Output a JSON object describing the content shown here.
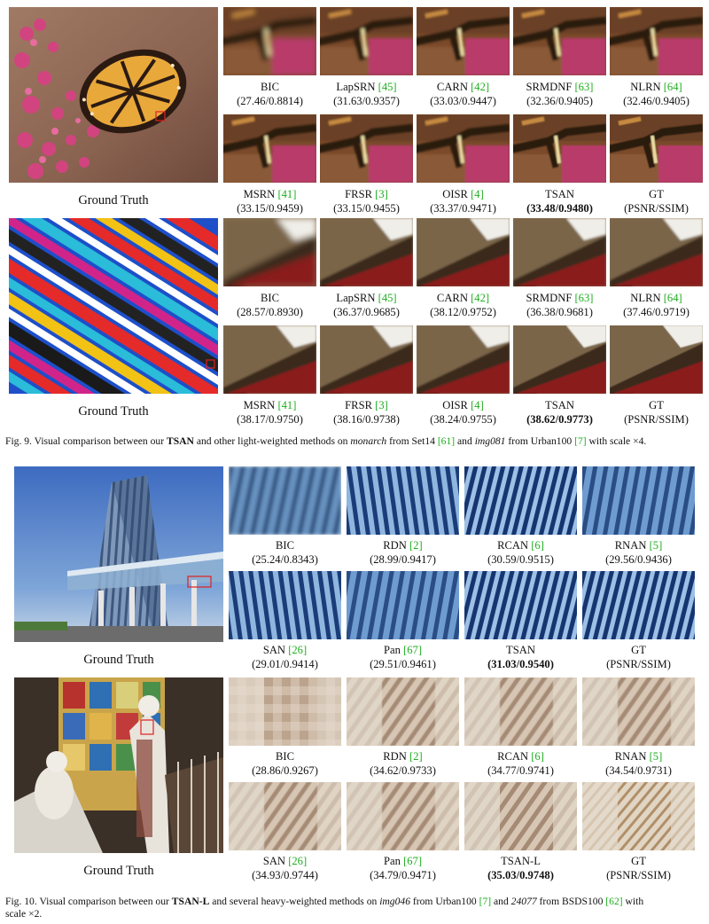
{
  "fig9": {
    "rows": [
      {
        "ground_truth_label": "Ground Truth",
        "crops": [
          {
            "method": "BIC",
            "ref": "",
            "score": "(27.46/0.8814)",
            "bold": false
          },
          {
            "method": "LapSRN",
            "ref": "[45]",
            "score": "(31.63/0.9357)",
            "bold": false
          },
          {
            "method": "CARN",
            "ref": "[42]",
            "score": "(33.03/0.9447)",
            "bold": false
          },
          {
            "method": "SRMDNF",
            "ref": "[63]",
            "score": "(32.36/0.9405)",
            "bold": false
          },
          {
            "method": "NLRN",
            "ref": "[64]",
            "score": "(32.46/0.9405)",
            "bold": false
          },
          {
            "method": "MSRN",
            "ref": "[41]",
            "score": "(33.15/0.9459)",
            "bold": false
          },
          {
            "method": "FRSR",
            "ref": "[3]",
            "score": "(33.15/0.9455)",
            "bold": false
          },
          {
            "method": "OISR",
            "ref": "[4]",
            "score": "(33.37/0.9471)",
            "bold": false
          },
          {
            "method": "TSAN",
            "ref": "",
            "score": "(33.48/0.9480)",
            "bold": true
          },
          {
            "method": "GT",
            "ref": "",
            "score": "(PSNR/SSIM)",
            "bold": false
          }
        ]
      },
      {
        "ground_truth_label": "Ground Truth",
        "crops": [
          {
            "method": "BIC",
            "ref": "",
            "score": "(28.57/0.8930)",
            "bold": false
          },
          {
            "method": "LapSRN",
            "ref": "[45]",
            "score": "(36.37/0.9685)",
            "bold": false
          },
          {
            "method": "CARN",
            "ref": "[42]",
            "score": "(38.12/0.9752)",
            "bold": false
          },
          {
            "method": "SRMDNF",
            "ref": "[63]",
            "score": "(36.38/0.9681)",
            "bold": false
          },
          {
            "method": "NLRN",
            "ref": "[64]",
            "score": "(37.46/0.9719)",
            "bold": false
          },
          {
            "method": "MSRN",
            "ref": "[41]",
            "score": "(38.17/0.9750)",
            "bold": false
          },
          {
            "method": "FRSR",
            "ref": "[3]",
            "score": "(38.16/0.9738)",
            "bold": false
          },
          {
            "method": "OISR",
            "ref": "[4]",
            "score": "(38.24/0.9755)",
            "bold": false
          },
          {
            "method": "TSAN",
            "ref": "",
            "score": "(38.62/0.9773)",
            "bold": true
          },
          {
            "method": "GT",
            "ref": "",
            "score": "(PSNR/SSIM)",
            "bold": false
          }
        ]
      }
    ],
    "caption": {
      "prefix": "Fig. 9.  Visual comparison between our ",
      "model": "TSAN",
      "mid1": " and other light-weighted methods on ",
      "img1": "monarch",
      "mid2": " from Set14 ",
      "ref1": "[61]",
      "mid3": " and ",
      "img2": "img081",
      "mid4": " from Urban100 ",
      "ref2": "[7]",
      "suffix": " with scale ×4."
    }
  },
  "fig10": {
    "rows": [
      {
        "ground_truth_label": "Ground Truth",
        "crops": [
          {
            "method": "BIC",
            "ref": "",
            "score": "(25.24/0.8343)",
            "bold": false
          },
          {
            "method": "RDN",
            "ref": "[2]",
            "score": "(28.99/0.9417)",
            "bold": false
          },
          {
            "method": "RCAN",
            "ref": "[6]",
            "score": "(30.59/0.9515)",
            "bold": false
          },
          {
            "method": "RNAN",
            "ref": "[5]",
            "score": "(29.56/0.9436)",
            "bold": false
          },
          {
            "method": "SAN",
            "ref": "[26]",
            "score": "(29.01/0.9414)",
            "bold": false
          },
          {
            "method": "Pan",
            "ref": "[67]",
            "score": "(29.51/0.9461)",
            "bold": false
          },
          {
            "method": "TSAN",
            "ref": "",
            "score": "(31.03/0.9540)",
            "bold": true
          },
          {
            "method": "GT",
            "ref": "",
            "score": "(PSNR/SSIM)",
            "bold": false
          }
        ]
      },
      {
        "ground_truth_label": "Ground Truth",
        "crops": [
          {
            "method": "BIC",
            "ref": "",
            "score": "(28.86/0.9267)",
            "bold": false
          },
          {
            "method": "RDN",
            "ref": "[2]",
            "score": "(34.62/0.9733)",
            "bold": false
          },
          {
            "method": "RCAN",
            "ref": "[6]",
            "score": "(34.77/0.9741)",
            "bold": false
          },
          {
            "method": "RNAN",
            "ref": "[5]",
            "score": "(34.54/0.9731)",
            "bold": false
          },
          {
            "method": "SAN",
            "ref": "[26]",
            "score": "(34.93/0.9744)",
            "bold": false
          },
          {
            "method": "Pan",
            "ref": "[67]",
            "score": "(34.79/0.9471)",
            "bold": false
          },
          {
            "method": "TSAN-L",
            "ref": "",
            "score": "(35.03/0.9748)",
            "bold": true
          },
          {
            "method": "GT",
            "ref": "",
            "score": "(PSNR/SSIM)",
            "bold": false
          }
        ]
      }
    ],
    "caption": {
      "prefix": "Fig. 10.  Visual comparison between our ",
      "model": "TSAN-L",
      "mid1": " and several heavy-weighted methods on ",
      "img1": "img046",
      "mid2": " from Urban100 ",
      "ref1": "[7]",
      "mid3": " and ",
      "img2": "24077",
      "mid4": " from BSDS100 ",
      "ref2": "[62]",
      "suffix": " with",
      "line2": "scale ×2."
    }
  },
  "colors": {
    "citation": "#1fae1f",
    "highlight_box": "#e02020"
  }
}
